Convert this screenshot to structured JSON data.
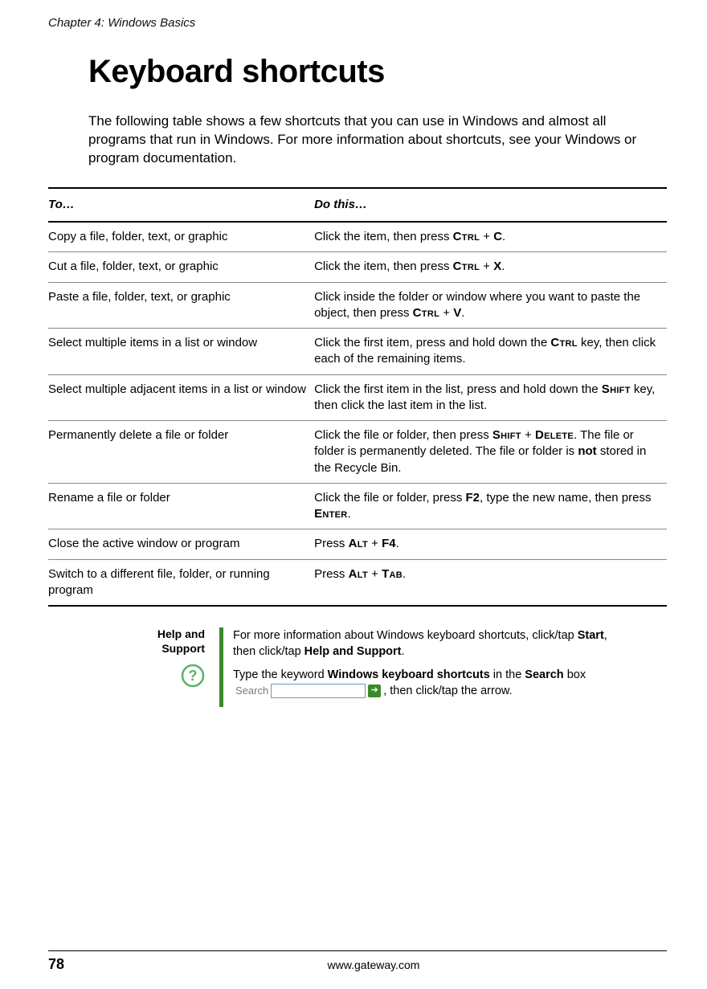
{
  "runningHeader": "Chapter 4: Windows Basics",
  "title": "Keyboard shortcuts",
  "intro": "The following table shows a few shortcuts that you can use in Windows and almost all programs that run in Windows. For more information about shortcuts, see your Windows or program documentation.",
  "table": {
    "headers": {
      "to": "To…",
      "do": "Do this…"
    },
    "rows": [
      {
        "to": "Copy a file, folder, text, or graphic",
        "do": "Click the item, then press <span class='sc'>Ctrl</span> + <span class='b'>C</span>."
      },
      {
        "to": "Cut a file, folder, text, or graphic",
        "do": "Click the item, then press <span class='sc'>Ctrl</span> + <span class='b'>X</span>."
      },
      {
        "to": "Paste a file, folder, text, or graphic",
        "do": "Click inside the folder or window where you want to paste the object, then press <span class='sc'>Ctrl</span> + <span class='b'>V</span>."
      },
      {
        "to": "Select multiple items in a list or window",
        "do": "Click the first item, press and hold down the <span class='sc'>Ctrl</span> key, then click each of the remaining items."
      },
      {
        "to": "Select multiple adjacent items in a list or window",
        "do": "Click the first item in the list, press and hold down the <span class='sc'>Shift</span> key, then click the last item in the list."
      },
      {
        "to": "Permanently delete a file or folder",
        "do": "Click the file or folder, then press <span class='sc'>Shift</span> + <span class='sc'>Delete</span>. The file or folder is permanently deleted. The file or folder is <span class='b'>not</span> stored in the Recycle Bin."
      },
      {
        "to": "Rename a file or folder",
        "do": "Click the file or folder, press <span class='b'>F2</span>, type the new name, then press <span class='sc'>Enter</span>."
      },
      {
        "to": "Close the active window or program",
        "do": "Press <span class='sc'>Alt</span> + <span class='b'>F4</span>."
      },
      {
        "to": "Switch to a different file, folder, or running program",
        "do": "Press <span class='sc'>Alt</span> + <span class='sc'>Tab</span>."
      }
    ]
  },
  "help": {
    "title": "Help and Support",
    "p1_pre": "For more information about Windows keyboard shortcuts, click/tap ",
    "p1_b1": "Start",
    "p1_mid": ", then click/tap ",
    "p1_b2": "Help and Support",
    "p1_post": ".",
    "p2_pre": "Type the keyword ",
    "p2_kw": "Windows keyboard shortcuts",
    "p2_mid": " in the ",
    "p2_sb": "Search",
    "p2_mid2": " box ",
    "p2_post": ", then click/tap the arrow.",
    "searchLabel": "Search"
  },
  "footer": {
    "pageNum": "78",
    "url": "www.gateway.com"
  }
}
